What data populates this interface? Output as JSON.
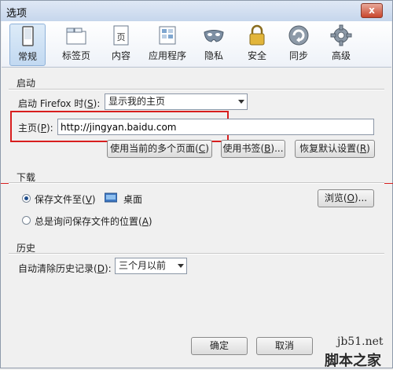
{
  "window": {
    "title": "选项",
    "close_glyph": "x"
  },
  "toolbar": {
    "items": [
      {
        "label": "常规",
        "icon": "general-icon"
      },
      {
        "label": "标签页",
        "icon": "tabs-icon"
      },
      {
        "label": "内容",
        "icon": "content-icon"
      },
      {
        "label": "应用程序",
        "icon": "applications-icon"
      },
      {
        "label": "隐私",
        "icon": "privacy-mask-icon"
      },
      {
        "label": "安全",
        "icon": "security-lock-icon"
      },
      {
        "label": "同步",
        "icon": "sync-icon"
      },
      {
        "label": "高级",
        "icon": "advanced-gear-icon"
      }
    ],
    "selected": "常规"
  },
  "startup": {
    "group_label": "启动",
    "when_label_pre": "启动 Firefox 时(",
    "when_label_key": "S",
    "when_label_post": "):",
    "when_value": "显示我的主页",
    "homepage_label_pre": "主页(",
    "homepage_label_key": "P",
    "homepage_label_post": "):",
    "homepage_value": "http://jingyan.baidu.com",
    "btn_current_pre": "使用当前的多个页面(",
    "btn_current_key": "C",
    "btn_current_post": ")",
    "btn_bookmark_pre": "使用书签(",
    "btn_bookmark_key": "B",
    "btn_bookmark_post": ")...",
    "btn_restore_pre": "恢复默认设置(",
    "btn_restore_key": "R",
    "btn_restore_post": ")"
  },
  "downloads": {
    "group_label": "下载",
    "save_to_pre": "保存文件至(",
    "save_to_key": "V",
    "save_to_post": ")",
    "save_to_folder": "桌面",
    "browse_pre": "浏览(",
    "browse_key": "O",
    "browse_post": ")...",
    "always_ask_pre": "总是询问保存文件的位置(",
    "always_ask_key": "A",
    "always_ask_post": ")",
    "selected_option": "save_to"
  },
  "history": {
    "group_label": "历史",
    "clear_label_pre": "自动清除历史记录(",
    "clear_label_key": "D",
    "clear_label_post": "):",
    "clear_value": "三个月以前"
  },
  "footer": {
    "ok_label": "确定",
    "cancel_label": "取消"
  },
  "watermark": {
    "site": "jb51.net",
    "brand": "脚本之家"
  },
  "colors": {
    "annotation_red": "#d81e1e",
    "accent_blue": "#1f4d8c"
  }
}
